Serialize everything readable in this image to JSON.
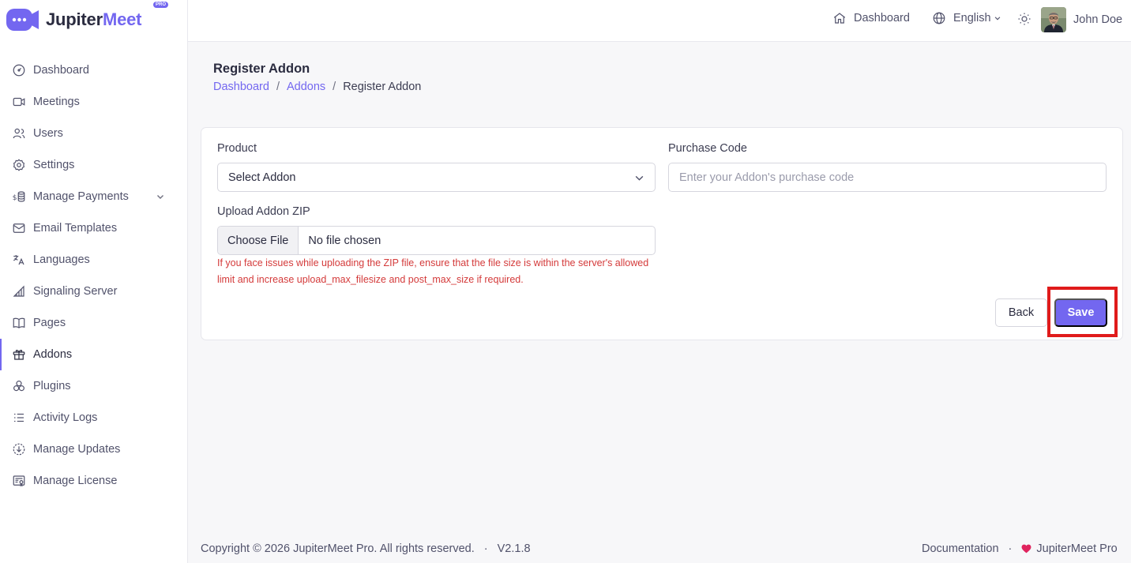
{
  "brand": {
    "name_main": "Jupiter",
    "name_accent": "Meet",
    "badge": "PRO",
    "accent_color": "#7367f0"
  },
  "sidebar": {
    "items": [
      {
        "label": "Dashboard",
        "icon": "gauge-icon"
      },
      {
        "label": "Meetings",
        "icon": "video-icon"
      },
      {
        "label": "Users",
        "icon": "users-icon"
      },
      {
        "label": "Settings",
        "icon": "gear-icon"
      },
      {
        "label": "Manage Payments",
        "icon": "coins-icon"
      },
      {
        "label": "Email Templates",
        "icon": "mail-icon"
      },
      {
        "label": "Languages",
        "icon": "language-icon"
      },
      {
        "label": "Signaling Server",
        "icon": "signal-icon"
      },
      {
        "label": "Pages",
        "icon": "book-icon"
      },
      {
        "label": "Addons",
        "icon": "gift-icon",
        "active": true
      },
      {
        "label": "Plugins",
        "icon": "plugins-icon"
      },
      {
        "label": "Activity Logs",
        "icon": "list-icon"
      },
      {
        "label": "Manage Updates",
        "icon": "download-circle-icon"
      },
      {
        "label": "Manage License",
        "icon": "license-icon"
      }
    ]
  },
  "header": {
    "dashboard": "Dashboard",
    "language": "English",
    "user_name": "John Doe"
  },
  "page": {
    "title": "Register Addon",
    "breadcrumb": {
      "home": "Dashboard",
      "parent": "Addons",
      "current": "Register Addon",
      "separator": "/"
    }
  },
  "form": {
    "product_label": "Product",
    "product_value": "Select Addon",
    "purchase_label": "Purchase Code",
    "purchase_placeholder": "Enter your Addon's purchase code",
    "upload_label": "Upload Addon ZIP",
    "choose_file": "Choose File",
    "no_file": "No file chosen",
    "hint": "If you face issues while uploading the ZIP file, ensure that the file size is within the server's allowed limit and increase upload_max_filesize and post_max_size if required.",
    "back": "Back",
    "save": "Save"
  },
  "footer": {
    "copyright": "Copyright © 2026 JupiterMeet Pro. All rights reserved.",
    "dot": "·",
    "version": "V2.1.8",
    "documentation": "Documentation",
    "product": "JupiterMeet Pro"
  }
}
